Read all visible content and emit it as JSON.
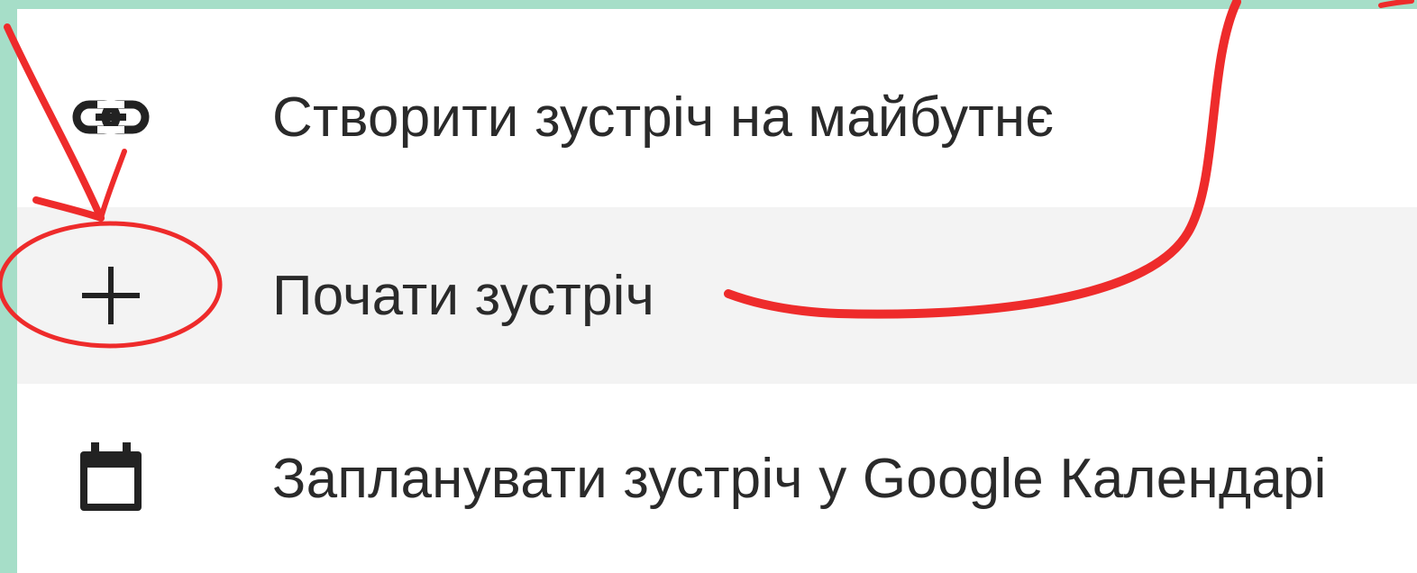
{
  "menu": {
    "items": [
      {
        "label": "Створити зустріч на майбутнє",
        "icon": "link-icon"
      },
      {
        "label": "Почати зустріч",
        "icon": "plus-icon",
        "highlighted": true
      },
      {
        "label": "Запланувати зустріч у Google Календарі",
        "icon": "calendar-icon"
      }
    ]
  },
  "annotation": {
    "color": "#ee2b2b"
  },
  "colors": {
    "frame": "#a6dec8",
    "highlight": "#f3f3f3",
    "text": "#2a2a2a"
  }
}
